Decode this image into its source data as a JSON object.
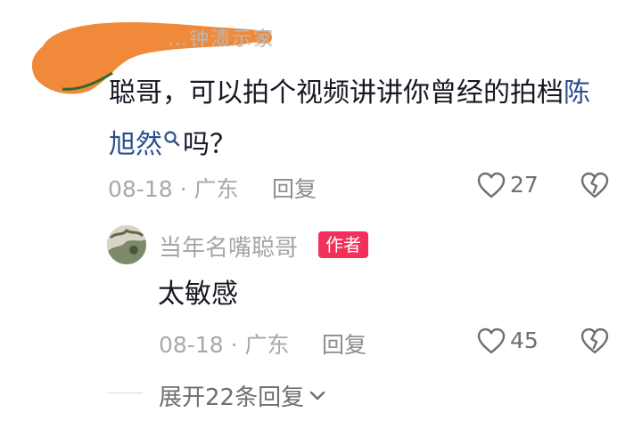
{
  "comment": {
    "redacted_name_fragment": "…钟溃示家",
    "text_before_mention": "聪哥，可以拍个视频讲讲你曾经的拍档",
    "mention": "陈旭然",
    "text_after_mention": "吗？",
    "date": "08-18",
    "separator": "·",
    "location": "广东",
    "reply_label": "回复",
    "like_count": "27"
  },
  "reply": {
    "author": "当年名嘴聪哥",
    "badge": "作者",
    "text": "太敏感",
    "date": "08-18",
    "separator": "·",
    "location": "广东",
    "reply_label": "回复",
    "like_count": "45"
  },
  "expand_replies_label": "展开22条回复",
  "icons": {
    "like": "heart-outline-icon",
    "dislike": "broken-heart-icon",
    "search": "search-icon",
    "expand": "chevron-down-icon"
  },
  "colors": {
    "redaction": "#f08a3a",
    "mention": "#2b4f8c",
    "author_badge": "#f2305a"
  }
}
